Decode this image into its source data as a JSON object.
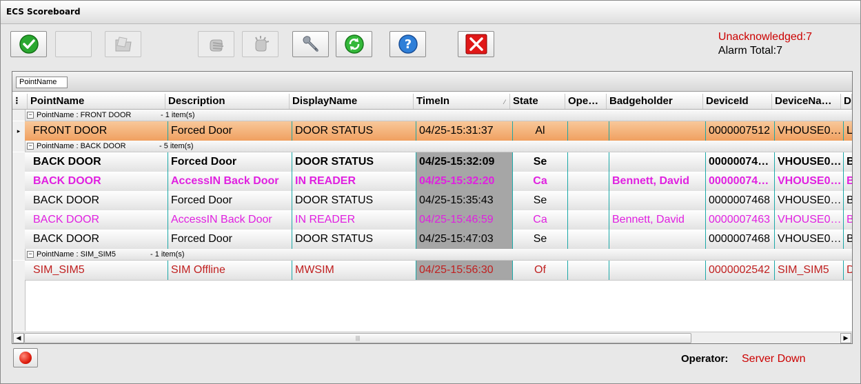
{
  "window": {
    "title": "ECS Scoreboard"
  },
  "toolbar": {
    "buttons": [
      {
        "name": "acknowledge-button",
        "icon": "checkmark-icon",
        "enabled": true
      },
      {
        "name": "blank-button",
        "icon": "",
        "enabled": false
      },
      {
        "name": "folder-button",
        "icon": "folder-icon",
        "enabled": false
      },
      {
        "name": "hand-button",
        "icon": "hand-icon",
        "enabled": false
      },
      {
        "name": "hand-burst-button",
        "icon": "hand-burst-icon",
        "enabled": false
      },
      {
        "name": "settings-button",
        "icon": "wrench-icon",
        "enabled": true
      },
      {
        "name": "refresh-button",
        "icon": "refresh-icon",
        "enabled": true
      },
      {
        "name": "help-button",
        "icon": "question-icon",
        "enabled": true
      },
      {
        "name": "close-button",
        "icon": "close-icon",
        "enabled": true
      }
    ]
  },
  "status": {
    "unacknowledged": "Unacknowledged:7",
    "alarm_total": "Alarm Total:7"
  },
  "grid": {
    "group_by_tag": "PointName",
    "columns": [
      "PointName",
      "Description",
      "DisplayName",
      "TimeIn",
      "State",
      "Ope…",
      "Badgeholder",
      "DeviceId",
      "DeviceNa…",
      "D"
    ],
    "groups": [
      {
        "header": "PointName : FRONT DOOR",
        "count": "- 1 item(s)",
        "rows": [
          {
            "cells": [
              "FRONT DOOR",
              "Forced Door",
              "DOOR STATUS",
              "04/25-15:31:37",
              "Al",
              "",
              "",
              "0000007512",
              "VHOUSE0…",
              "Lo"
            ],
            "style": "selected",
            "color": "#000000"
          }
        ]
      },
      {
        "header": "PointName : BACK DOOR",
        "count": "- 5 item(s)",
        "rows": [
          {
            "cells": [
              "BACK DOOR",
              "Forced Door",
              "DOOR STATUS",
              "04/25-15:32:09",
              "Se",
              "",
              "",
              "00000074…",
              "VHOUSE0…",
              "B"
            ],
            "style": "bold",
            "color": "#000000"
          },
          {
            "cells": [
              "BACK DOOR",
              "AccessIN Back Door",
              "IN READER",
              "04/25-15:32:20",
              "Ca",
              "",
              "Bennett, David",
              "00000074…",
              "VHOUSE0…",
              "B"
            ],
            "style": "bold",
            "color": "#e020e0"
          },
          {
            "cells": [
              "BACK DOOR",
              "Forced Door",
              "DOOR STATUS",
              "04/25-15:35:43",
              "Se",
              "",
              "",
              "0000007468",
              "VHOUSE0…",
              "B"
            ],
            "style": "normal",
            "color": "#000000"
          },
          {
            "cells": [
              "BACK DOOR",
              "AccessIN Back Door",
              "IN READER",
              "04/25-15:46:59",
              "Ca",
              "",
              "Bennett, David",
              "0000007463",
              "VHOUSE0…",
              "B"
            ],
            "style": "normal",
            "color": "#e020e0"
          },
          {
            "cells": [
              "BACK DOOR",
              "Forced Door",
              "DOOR STATUS",
              "04/25-15:47:03",
              "Se",
              "",
              "",
              "0000007468",
              "VHOUSE0…",
              "B"
            ],
            "style": "normal",
            "color": "#000000"
          }
        ]
      },
      {
        "header": "PointName : SIM_SIM5",
        "count": "- 1 item(s)",
        "rows": [
          {
            "cells": [
              "SIM_SIM5",
              "SIM Offline",
              "MWSIM",
              "04/25-15:56:30",
              "Of",
              "",
              "",
              "0000002542",
              "SIM_SIM5",
              "D"
            ],
            "style": "normal",
            "color": "#c02020"
          }
        ]
      }
    ]
  },
  "footer": {
    "operator_label": "Operator:",
    "operator_value": "Server Down"
  }
}
